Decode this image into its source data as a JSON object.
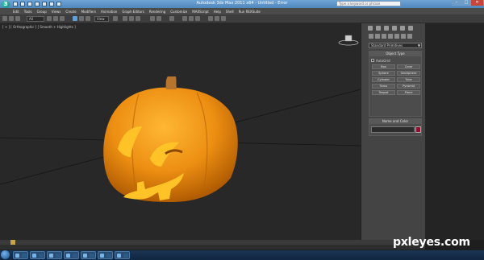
{
  "window": {
    "title": "Autodesk 3ds Max 2011 x64 - Untitled - Error",
    "search_placeholder": "Type a keyword or phrase",
    "min_glyph": "–",
    "max_glyph": "□",
    "close_glyph": "✕",
    "logo_letter": "3"
  },
  "menu": {
    "items": [
      "Edit",
      "Tools",
      "Group",
      "Views",
      "Create",
      "Modifiers",
      "Animation",
      "Graph Editors",
      "Rendering",
      "Customize",
      "MAXScript",
      "Help",
      "Shell",
      "Run REXSuite"
    ]
  },
  "toolbar": {
    "selection_filter": "All",
    "reference_coord": "View"
  },
  "viewport": {
    "label": "[ + ] [ Orthographic ] [ Smooth + Highlights ]"
  },
  "command_panel": {
    "category_dropdown": "Standard Primitives",
    "object_type_title": "Object Type",
    "autogrid_label": "AutoGrid",
    "primitives": [
      "Box",
      "Cone",
      "Sphere",
      "GeoSphere",
      "Cylinder",
      "Tube",
      "Torus",
      "Pyramid",
      "Teapot",
      "Plane"
    ],
    "name_color_title": "Name and Color",
    "object_color": "#8c1030"
  },
  "status": {
    "add_time_tag": "Add Time Tag"
  },
  "colors": {
    "pumpkin": "#e48a12",
    "stem": "#b7742f",
    "viewport_bg": "#282828",
    "title_blue": "#4f86bd"
  },
  "watermark": {
    "text": "pxleyes.com"
  }
}
